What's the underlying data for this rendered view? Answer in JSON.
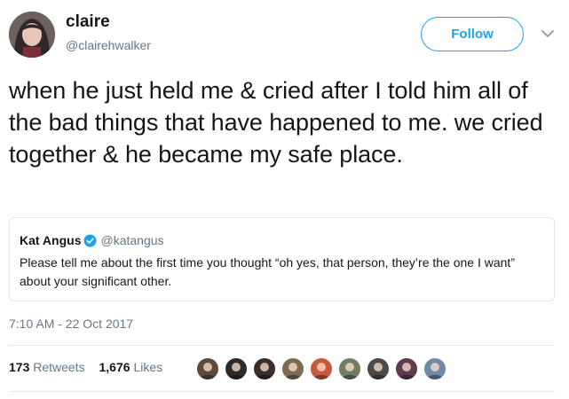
{
  "author": {
    "display_name": "claire",
    "handle": "@clairehwalker",
    "avatar_colors": [
      "#5a4a4c",
      "#e8c6b8",
      "#2e2629"
    ]
  },
  "follow_label": "Follow",
  "tweet": {
    "text": "when he just held me & cried after I told him all of the bad things that have happened to me. we cried together & he became my safe place."
  },
  "quoted_tweet": {
    "name": "Kat Angus",
    "handle": "@katangus",
    "verified": true,
    "text": "Please tell me about the first time you thought “oh yes, that person, they’re the one I want” about your significant other."
  },
  "timestamp": "7:10 AM - 22 Oct 2017",
  "stats": {
    "retweets_count": "173",
    "retweets_label": "Retweets",
    "likes_count": "1,676",
    "likes_label": "Likes"
  },
  "likers": [
    {
      "name": "liker-1",
      "color": "#5b4a3f"
    },
    {
      "name": "liker-2",
      "color": "#2b2b2b"
    },
    {
      "name": "liker-3",
      "color": "#3a2d2a"
    },
    {
      "name": "liker-4",
      "color": "#7d6a55"
    },
    {
      "name": "liker-5",
      "color": "#c65a3e"
    },
    {
      "name": "liker-6",
      "color": "#6f7d62"
    },
    {
      "name": "liker-7",
      "color": "#4b4a48"
    },
    {
      "name": "liker-8",
      "color": "#5e3b4e"
    },
    {
      "name": "liker-9",
      "color": "#6f8aa3"
    }
  ],
  "colors": {
    "accent": "#1da1f2",
    "text": "#14171a",
    "muted": "#657786"
  }
}
